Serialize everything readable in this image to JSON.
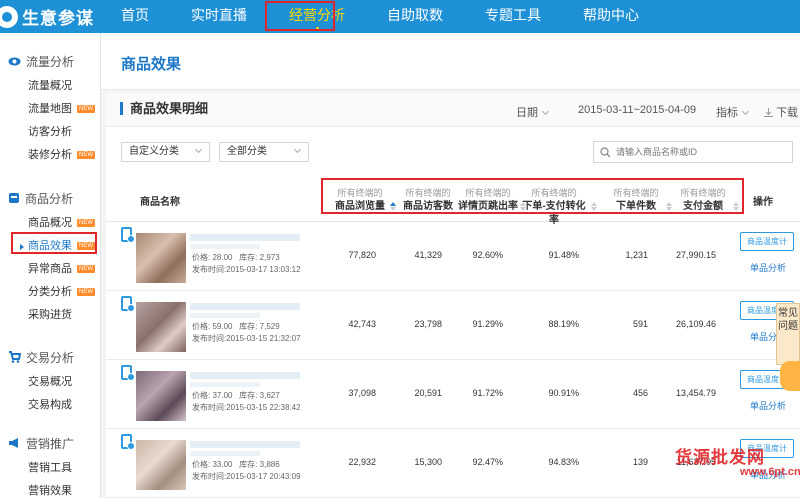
{
  "brand": "生意参谋",
  "nav": [
    "首页",
    "实时直播",
    "经营分析",
    "自助取数",
    "专题工具",
    "帮助中心"
  ],
  "sidebar": [
    {
      "title": "流量分析",
      "icon": "eye-icon",
      "items": [
        {
          "label": "流量概况",
          "new": ""
        },
        {
          "label": "流量地图",
          "new": "NEW"
        },
        {
          "label": "访客分析",
          "new": ""
        },
        {
          "label": "装修分析",
          "new": "NEW"
        }
      ]
    },
    {
      "title": "商品分析",
      "icon": "box-icon",
      "items": [
        {
          "label": "商品概况",
          "new": "NEW"
        },
        {
          "label": "商品效果",
          "new": "NEW"
        },
        {
          "label": "异常商品",
          "new": "NEW"
        },
        {
          "label": "分类分析",
          "new": "NEW"
        },
        {
          "label": "采购进货",
          "new": ""
        }
      ]
    },
    {
      "title": "交易分析",
      "icon": "cart-icon",
      "items": [
        {
          "label": "交易概况",
          "new": ""
        },
        {
          "label": "交易构成",
          "new": ""
        }
      ]
    },
    {
      "title": "营销推广",
      "icon": "megaphone-icon",
      "items": [
        {
          "label": "营销工具",
          "new": ""
        },
        {
          "label": "营销效果",
          "new": ""
        }
      ]
    }
  ],
  "page_title": "商品效果",
  "panel": {
    "title": "商品效果明细",
    "date_label": "日期",
    "date_range": "2015-03-11~2015-04-09",
    "metric_label": "指标",
    "download_label": "下载"
  },
  "filters": {
    "category1": "自定义分类",
    "category2": "全部分类",
    "search_placeholder": "请输入商品名称或ID"
  },
  "table": {
    "col_name": "商品名称",
    "col_op": "操作",
    "metric_sub": "所有终端的",
    "metrics": [
      "商品浏览量",
      "商品访客数",
      "详情页跳出率",
      "下单-支付转化率",
      "下单件数",
      "支付金额"
    ],
    "price_label": "价格:",
    "stock_label": "库存:",
    "publish_label": "发布时间:",
    "btn_label": "商品温度计",
    "link_label": "单品分析",
    "rows": [
      {
        "price": "28.00",
        "stock": "2,973",
        "publish": "2015-03-17 13:03:12",
        "values": [
          "77,820",
          "41,329",
          "92.60%",
          "91.48%",
          "1,231",
          "27,990.15"
        ]
      },
      {
        "price": "59.00",
        "stock": "7,529",
        "publish": "2015-03-15 21:32:07",
        "values": [
          "42,743",
          "23,798",
          "91.29%",
          "88.19%",
          "591",
          "26,109.46"
        ]
      },
      {
        "price": "37.00",
        "stock": "3,627",
        "publish": "2015-03-15 22:38:42",
        "values": [
          "37,098",
          "20,591",
          "91.72%",
          "90.91%",
          "456",
          "13,454.79"
        ]
      },
      {
        "price": "33.00",
        "stock": "3,886",
        "publish": "2015-03-17 20:43:09",
        "values": [
          "22,932",
          "15,300",
          "92.47%",
          "94.83%",
          "139",
          "11,637.05"
        ]
      }
    ]
  },
  "float_faq": "常见问题",
  "watermark": "货源批发网",
  "watermark2": "www.6pt.cn"
}
